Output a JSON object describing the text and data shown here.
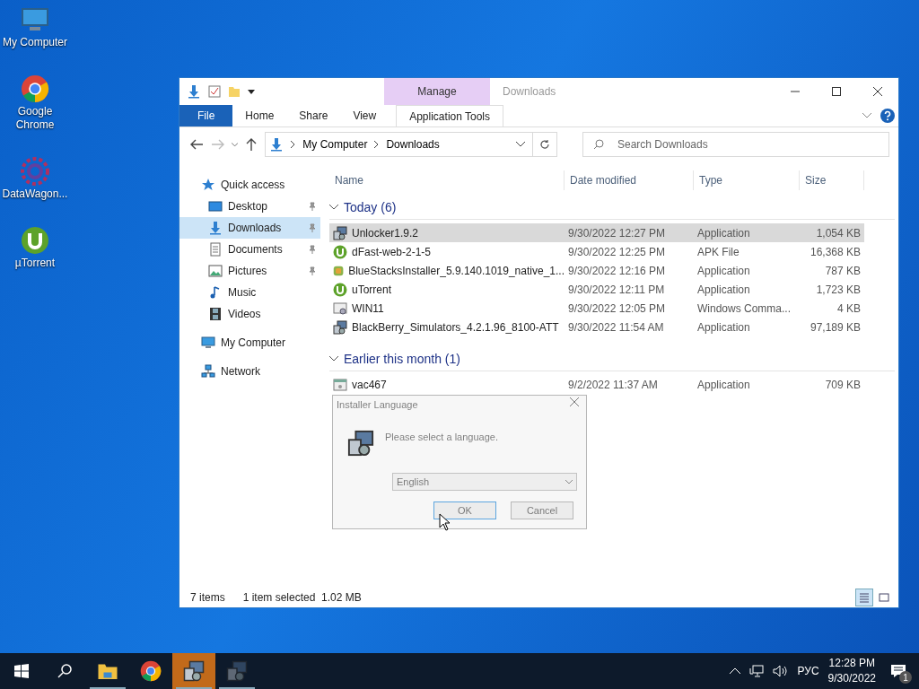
{
  "desktop_icons": [
    {
      "label": "My Computer",
      "kind": "computer"
    },
    {
      "label": "Google Chrome",
      "kind": "chrome"
    },
    {
      "label": "DataWagon...",
      "kind": "datawagon"
    },
    {
      "label": "µTorrent",
      "kind": "utorrent"
    }
  ],
  "window": {
    "title": "Downloads",
    "contextual_group": "Manage",
    "tabs": [
      {
        "label": "File",
        "kind": "file",
        "selected": false
      },
      {
        "label": "Home",
        "kind": "tab",
        "selected": false
      },
      {
        "label": "Share",
        "kind": "tab",
        "selected": false
      },
      {
        "label": "View",
        "kind": "tab",
        "selected": false
      },
      {
        "label": "Application Tools",
        "kind": "contextual",
        "selected": false
      }
    ],
    "address": {
      "path": [
        "My Computer",
        "Downloads"
      ]
    },
    "search": {
      "placeholder": "Search Downloads"
    },
    "nav": [
      {
        "label": "Quick access",
        "kind": "star",
        "selected": false,
        "children": [
          {
            "label": "Desktop",
            "kind": "desktop",
            "pinned": true,
            "selected": false
          },
          {
            "label": "Downloads",
            "kind": "downloads",
            "pinned": true,
            "selected": true
          },
          {
            "label": "Documents",
            "kind": "documents",
            "pinned": true,
            "selected": false
          },
          {
            "label": "Pictures",
            "kind": "pictures",
            "pinned": true,
            "selected": false
          },
          {
            "label": "Music",
            "kind": "music",
            "pinned": false,
            "selected": false
          },
          {
            "label": "Videos",
            "kind": "videos",
            "pinned": false,
            "selected": false
          }
        ]
      },
      {
        "label": "My Computer",
        "kind": "computer",
        "selected": false
      },
      {
        "label": "Network",
        "kind": "network",
        "selected": false
      }
    ],
    "columns": [
      "Name",
      "Date modified",
      "Type",
      "Size"
    ],
    "groups": [
      {
        "title": "Today (6)",
        "expanded": true,
        "rows": [
          {
            "name": "Unlocker1.9.2",
            "date": "9/30/2022 12:27 PM",
            "type": "Application",
            "size": "1,054 KB",
            "kind": "installer",
            "selected": true
          },
          {
            "name": "dFast-web-2-1-5",
            "date": "9/30/2022 12:25 PM",
            "type": "APK File",
            "size": "16,368 KB",
            "kind": "utorrent",
            "selected": false
          },
          {
            "name": "BlueStacksInstaller_5.9.140.1019_native_1...",
            "date": "9/30/2022 12:16 PM",
            "type": "Application",
            "size": "787 KB",
            "kind": "bluestacks",
            "selected": false
          },
          {
            "name": "uTorrent",
            "date": "9/30/2022 12:11 PM",
            "type": "Application",
            "size": "1,723 KB",
            "kind": "utorrent",
            "selected": false
          },
          {
            "name": "WIN11",
            "date": "9/30/2022 12:05 PM",
            "type": "Windows Comma...",
            "size": "4 KB",
            "kind": "cmd",
            "selected": false
          },
          {
            "name": "BlackBerry_Simulators_4.2.1.96_8100-ATT",
            "date": "9/30/2022 11:54 AM",
            "type": "Application",
            "size": "97,189 KB",
            "kind": "installer",
            "selected": false
          }
        ]
      },
      {
        "title": "Earlier this month (1)",
        "expanded": true,
        "rows": [
          {
            "name": "vac467",
            "date": "9/2/2022 11:37 AM",
            "type": "Application",
            "size": "709 KB",
            "kind": "app",
            "selected": false
          }
        ]
      }
    ],
    "status": {
      "items": "7 items",
      "selection": "1 item selected  1.02 MB"
    }
  },
  "dialog": {
    "title": "Installer Language",
    "message": "Please select a language.",
    "language": "English",
    "buttons": [
      {
        "label": "OK",
        "kind": "default"
      },
      {
        "label": "Cancel",
        "kind": "normal"
      }
    ]
  },
  "taskbar": {
    "apps": [
      {
        "kind": "explorer",
        "active": false,
        "running": true
      },
      {
        "kind": "chrome",
        "active": false,
        "running": false
      },
      {
        "kind": "installer",
        "active": true,
        "running": true
      },
      {
        "kind": "installer-faded",
        "active": false,
        "running": true
      }
    ],
    "language": "РУС",
    "time": "12:28 PM",
    "date": "9/30/2022",
    "notifications": "1"
  }
}
